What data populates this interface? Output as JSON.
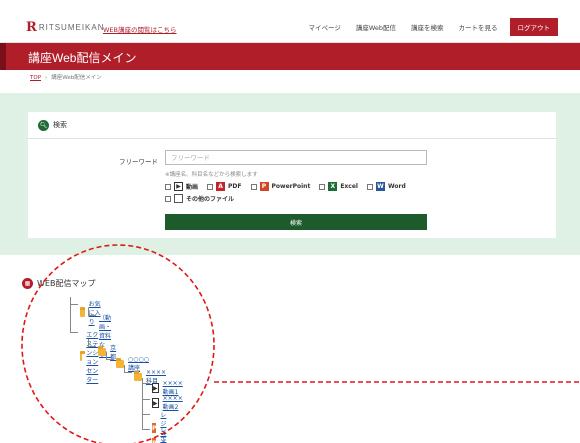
{
  "header": {
    "logo_letter": "R",
    "logo_text": "RITSUMEIKAN",
    "web_link": "WEB講座の閲覧はこちら",
    "nav": [
      "マイページ",
      "講座Web配信",
      "講座を検索",
      "カートを見る"
    ],
    "logout": "ログアウト"
  },
  "page_title": "講座Web配信メイン",
  "breadcrumb": {
    "top": "TOP",
    "current": "講座Web配信メイン"
  },
  "search": {
    "title": "検索",
    "freeword_label": "フリーワード",
    "freeword_placeholder": "フリーワード",
    "hint": "※講座名、科目名などから検索します",
    "filetypes": [
      {
        "label": "動画",
        "icon": "video-icon"
      },
      {
        "label": "PDF",
        "icon": "pdf-icon"
      },
      {
        "label": "PowerPoint",
        "icon": "powerpoint-icon"
      },
      {
        "label": "Excel",
        "icon": "excel-icon"
      },
      {
        "label": "Word",
        "icon": "word-icon"
      },
      {
        "label": "その他のファイル",
        "icon": "file-icon"
      }
    ],
    "button": "検索"
  },
  "map": {
    "title": "WEB配信マップ",
    "favorites": "お気に入り",
    "favorites_sub": "（動画・資料なし）",
    "extension_center": "エクステンションセンター",
    "kyoto": "京都",
    "course": "○○○○講座",
    "subject": "××××科目",
    "video1": "××××動画1",
    "video2": "××××動画2",
    "resume": "レジュメ",
    "report": "レポート"
  },
  "colors": {
    "brand": "#b01e2a",
    "search_green": "#1d5a2c",
    "search_bg": "#dff1e5",
    "annotation": "#e01818"
  }
}
